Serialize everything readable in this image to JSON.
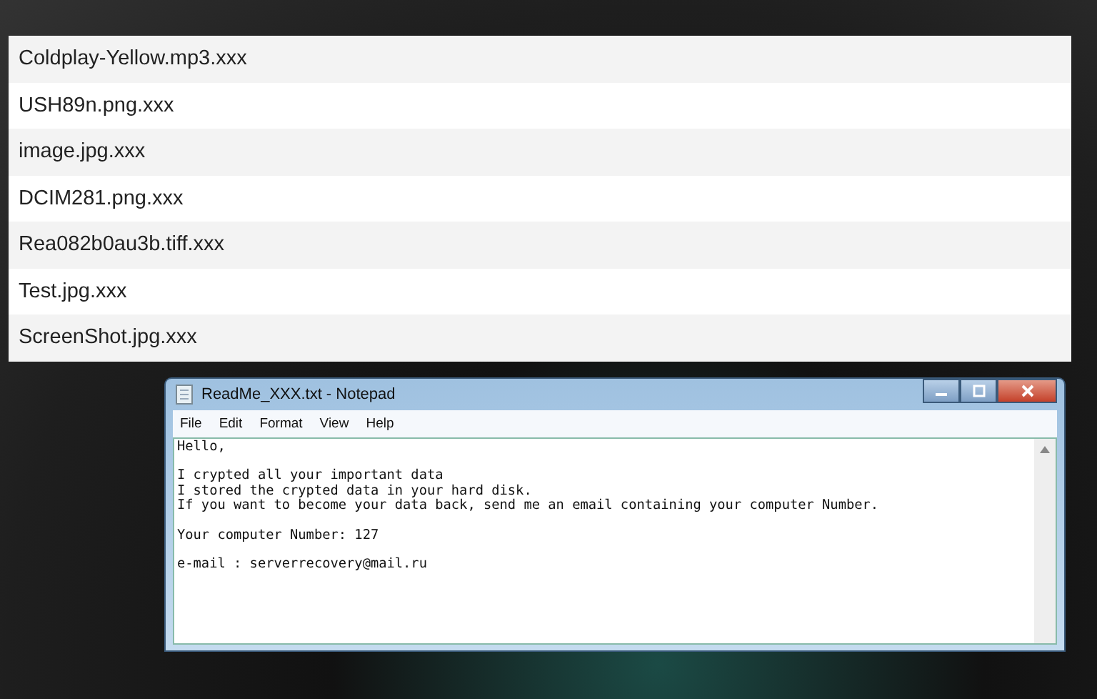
{
  "files": [
    "Coldplay-Yellow.mp3.xxx",
    "USH89n.png.xxx",
    "image.jpg.xxx",
    "DCIM281.png.xxx",
    "Rea082b0au3b.tiff.xxx",
    "Test.jpg.xxx",
    "ScreenShot.jpg.xxx"
  ],
  "notepad": {
    "title": "ReadMe_XXX.txt - Notepad",
    "menu": [
      "File",
      "Edit",
      "Format",
      "View",
      "Help"
    ],
    "paragraphs": [
      [
        "Hello,"
      ],
      [
        "I crypted all your important data",
        "I stored the crypted data in your hard disk.",
        "If you want to become your data back, send me an email containing your computer Number."
      ],
      [
        "Your computer Number: 127"
      ],
      [
        "e-mail : serverrecovery@mail.ru"
      ]
    ]
  }
}
